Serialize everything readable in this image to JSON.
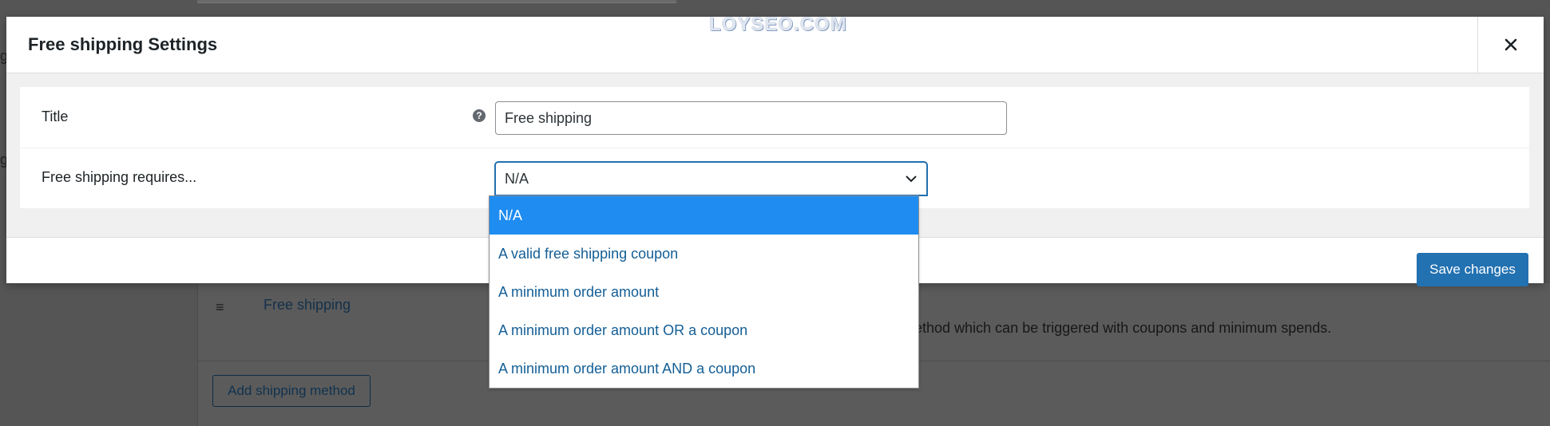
{
  "modal": {
    "title": "Free shipping Settings",
    "watermark": "LOYSEO.COM",
    "close_icon": "close-icon",
    "fields": {
      "title": {
        "label": "Title",
        "help_icon": "question-mark-icon",
        "value": "Free shipping"
      },
      "requires": {
        "label": "Free shipping requires...",
        "selected": "N/A",
        "chevron_icon": "chevron-down-icon",
        "options": [
          "N/A",
          "A valid free shipping coupon",
          "A minimum order amount",
          "A minimum order amount OR a coupon",
          "A minimum order amount AND a coupon"
        ]
      }
    },
    "save_label": "Save changes"
  },
  "background": {
    "method_name": "Free shipping",
    "method_description": "method which can be triggered with coupons and minimum spends.",
    "add_method_label": "Add shipping method",
    "edge_letter_1": "g",
    "edge_letter_2": "g"
  },
  "colors": {
    "accent": "#2271b1",
    "highlight": "#1e8cf0",
    "overlay": "#555555"
  }
}
